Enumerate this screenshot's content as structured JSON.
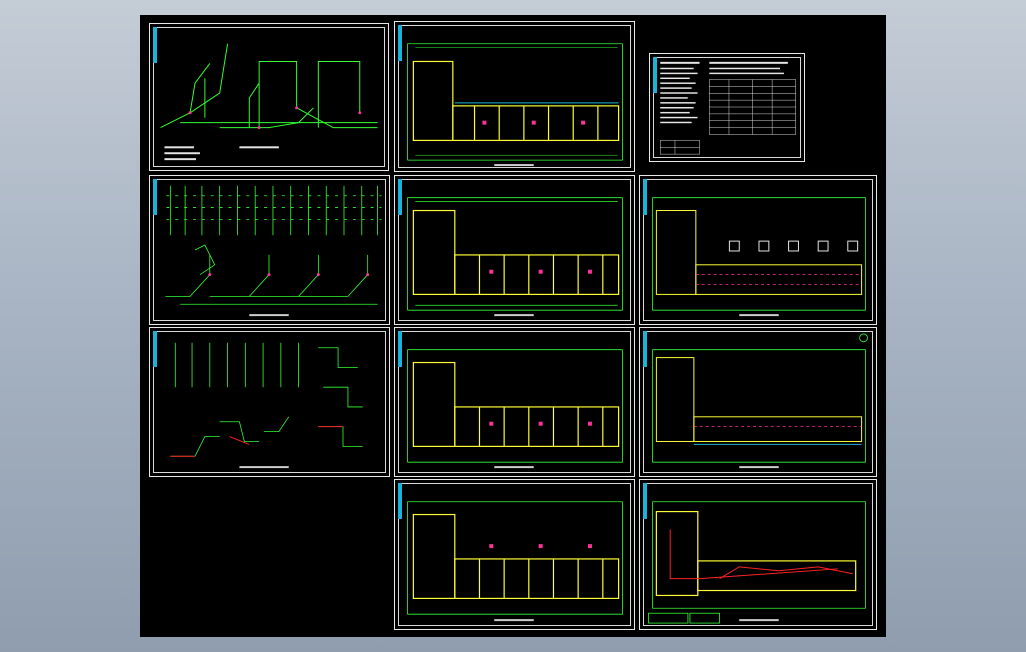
{
  "viewer": {
    "background": "model-space",
    "drawing_sheets": 11
  },
  "sheets": [
    {
      "id": "s1",
      "kind": "riser-diagram"
    },
    {
      "id": "s2",
      "kind": "floor-plan"
    },
    {
      "id": "s3",
      "kind": "notes-table"
    },
    {
      "id": "s4",
      "kind": "riser-diagram"
    },
    {
      "id": "s5",
      "kind": "floor-plan"
    },
    {
      "id": "s6",
      "kind": "floor-plan"
    },
    {
      "id": "s7",
      "kind": "riser-diagram"
    },
    {
      "id": "s8",
      "kind": "floor-plan"
    },
    {
      "id": "s9",
      "kind": "floor-plan"
    },
    {
      "id": "s10",
      "kind": "floor-plan"
    },
    {
      "id": "s11",
      "kind": "floor-plan"
    }
  ],
  "colors": {
    "pipe": "#33ff33",
    "wall": "#ffff33",
    "accent": "#ff3399",
    "red": "#ff2222",
    "cyan": "#19b4d8",
    "text": "#e6e6e6"
  }
}
